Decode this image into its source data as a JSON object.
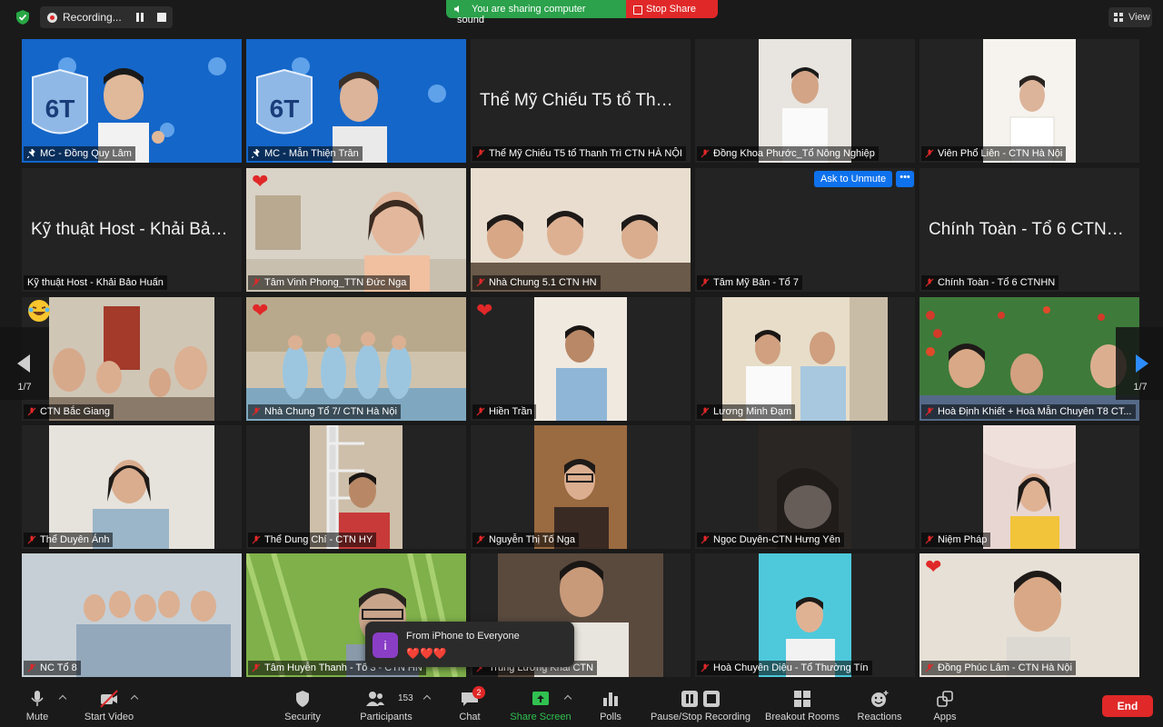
{
  "status": {
    "recording_label": "Recording..."
  },
  "share_banner": {
    "sound_text": "You are sharing computer sound",
    "stop_label": "Stop Share"
  },
  "view_label": "View",
  "page_indicator": "1/7",
  "ask_to_unmute": "Ask to Unmute",
  "more_label": "•••",
  "chat_toast": {
    "avatar": "i",
    "title": "From iPhone to Everyone",
    "message": "❤️❤️❤️"
  },
  "tiles": [
    {
      "name": "MC - Đồng Quy Lâm",
      "active": true
    },
    {
      "name": "MC - Mẫn Thiện Trân"
    },
    {
      "name": "Thể Mỹ Chiếu T5 tổ Thanh Trì CTN HÀ NỘI",
      "center_text": "Thể Mỹ Chiếu T5 tổ Thanh..."
    },
    {
      "name": "Đồng Khoa Phước_Tổ Nông Nghiệp"
    },
    {
      "name": "Viên Phổ Liên - CTN Hà Nội"
    },
    {
      "name": "Kỹ thuật Host - Khải Bảo Huấn",
      "center_text": "Kỹ thuật Host - Khải Bảo H..."
    },
    {
      "name": "Tâm Vinh Phong_TTN Đức Nga",
      "reaction": "heart"
    },
    {
      "name": "Nhà Chung 5.1 CTN HN"
    },
    {
      "name": "Tâm Mỹ Bản - Tổ 7"
    },
    {
      "name": "Chính Toàn - Tổ 6 CTNHN",
      "center_text": "Chính Toàn - Tổ 6 CTNHN"
    },
    {
      "name": "CTN Bắc Giang",
      "reaction": "laugh"
    },
    {
      "name": "Nhà Chung Tổ 7/ CTN Hà Nội",
      "reaction": "heart"
    },
    {
      "name": "Hiền Trần",
      "reaction": "heart"
    },
    {
      "name": "Lương Minh Đạm"
    },
    {
      "name": "Hoà Định Khiết + Hoà Mẫn Chuyên T8 CT..."
    },
    {
      "name": "Thể Duyên Ánh"
    },
    {
      "name": "Thể Dung Chí - CTN HY"
    },
    {
      "name": "Nguyễn Thị Tố Nga"
    },
    {
      "name": "Ngọc Duyên-CTN Hưng Yên"
    },
    {
      "name": "Niệm Pháp"
    },
    {
      "name": "NC Tổ 8"
    },
    {
      "name": "Tâm Huyễn Thanh - Tổ 3 - CTN HN"
    },
    {
      "name": "Trung Lương Khải CTN"
    },
    {
      "name": "Hoà Chuyên Diệu - Tổ Thường Tín"
    },
    {
      "name": "Đồng Phúc Lâm - CTN Hà Nội",
      "reaction": "heart"
    }
  ],
  "toolbar": {
    "mute": "Mute",
    "start_video": "Start Video",
    "security": "Security",
    "participants": "Participants",
    "participants_count": "153",
    "chat": "Chat",
    "chat_badge": "2",
    "share_screen": "Share Screen",
    "polls": "Polls",
    "pause_stop_recording": "Pause/Stop Recording",
    "breakout_rooms": "Breakout Rooms",
    "reactions": "Reactions",
    "apps": "Apps",
    "end": "End"
  },
  "colors": {
    "accent_blue": "#0e72ed",
    "end_red": "#e02828",
    "share_green": "#2ba24b",
    "active_border": "#e8e37a"
  }
}
